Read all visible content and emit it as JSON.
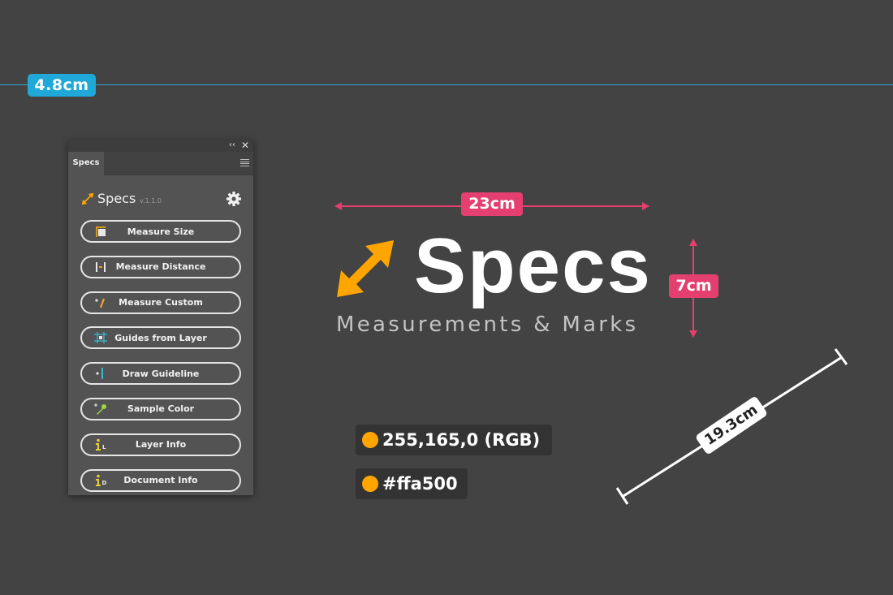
{
  "guide": {
    "label": "4.8cm",
    "color": "#1fa8d8"
  },
  "panel": {
    "titlebar": {
      "collapse_icon": "double-chevron-left-icon",
      "close_icon": "close-icon",
      "collapse_glyph": "‹‹",
      "close_glyph": "✕"
    },
    "tab_label": "Specs",
    "menu_icon": "hamburger-menu-icon",
    "header": {
      "title": "Specs",
      "version": "v.1.1.0",
      "settings_icon": "gear-icon"
    },
    "buttons": [
      {
        "label": "Measure Size",
        "icon": "measure-size-icon"
      },
      {
        "label": "Measure Distance",
        "icon": "measure-distance-icon"
      },
      {
        "label": "Measure Custom",
        "icon": "measure-custom-icon"
      },
      {
        "label": "Guides from Layer",
        "icon": "guides-from-layer-icon"
      },
      {
        "label": "Draw Guideline",
        "icon": "draw-guideline-icon"
      },
      {
        "label": "Sample Color",
        "icon": "eyedropper-icon"
      },
      {
        "label": "Layer Info",
        "icon": "layer-info-icon"
      },
      {
        "label": "Document Info",
        "icon": "document-info-icon"
      }
    ]
  },
  "hero": {
    "title": "Specs",
    "subtitle": "Measurements & Marks",
    "width_label": "23cm",
    "height_label": "7cm",
    "accent_color": "#ffa500",
    "dimension_color": "#e43f6f"
  },
  "color_samples": {
    "rgb_label": "255,165,0 (RGB)",
    "hex_label": "#ffa500",
    "swatch_color": "#ffa500"
  },
  "diagonal_measure": {
    "label": "19.3cm"
  }
}
